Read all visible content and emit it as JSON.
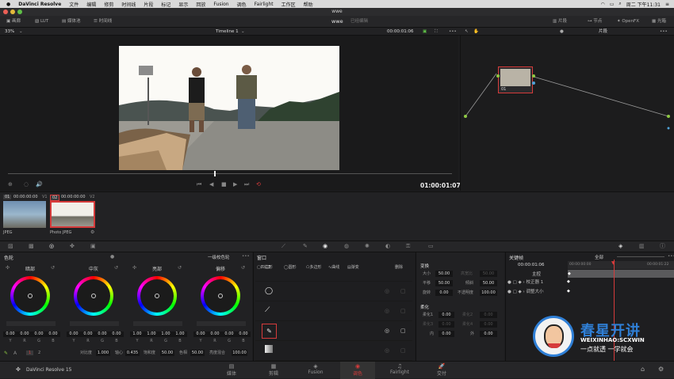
{
  "menubar": {
    "app": "DaVinci Resolve",
    "items": [
      "文件",
      "编辑",
      "修剪",
      "时间线",
      "片段",
      "标记",
      "显示",
      "回放",
      "Fusion",
      "调色",
      "Fairlight",
      "工作区",
      "帮助"
    ],
    "clock": "周二 下午11:31"
  },
  "window": {
    "title": "wwe"
  },
  "toolbar": {
    "gallery": "画廊",
    "lut": "LUT",
    "media_pool": "媒体池",
    "timeline": "时间线",
    "project": "wwe",
    "edited": "已经编辑",
    "clips": "片段",
    "nodes": "节点",
    "openfx": "OpenFX",
    "lightbox": "光箱"
  },
  "viewer": {
    "zoom": "33%",
    "timeline_name": "Timeline 1",
    "timecode": "00:00:01:06",
    "current_tc": "01:00:01:07",
    "node_mode": "片段"
  },
  "node": {
    "label": "01"
  },
  "clips": [
    {
      "index": "01",
      "tc": "00:00:00:00",
      "track": "V1",
      "name": "JPEG"
    },
    {
      "index": "02",
      "tc": "00:00:00:00",
      "track": "V2",
      "name": "Photo JPEG"
    }
  ],
  "wheels": {
    "panel_title": "色轮",
    "mode": "一级校色轮",
    "items": [
      {
        "title": "暗部",
        "values": [
          "0.00",
          "0.00",
          "0.00",
          "0.00"
        ]
      },
      {
        "title": "中灰",
        "values": [
          "0.00",
          "0.00",
          "0.00",
          "0.00"
        ]
      },
      {
        "title": "亮部",
        "values": [
          "1.00",
          "1.00",
          "1.00",
          "1.00"
        ]
      },
      {
        "title": "偏移",
        "values": [
          "0.00",
          "0.00",
          "0.00",
          "0.00"
        ]
      }
    ],
    "channels": [
      "Y",
      "R",
      "G",
      "B"
    ],
    "page1": "1",
    "page2": "2",
    "contrast_label": "对比度",
    "contrast": "1.000",
    "pivot_label": "轴心",
    "pivot": "0.435",
    "saturation_label": "饱和度",
    "saturation": "50.00",
    "hue_label": "色相",
    "hue": "50.00",
    "lum_mix_label": "亮度混合",
    "lum_mix": "100.00"
  },
  "window_panel": {
    "title": "窗口",
    "shapes": [
      "四边形",
      "圆形",
      "多边形",
      "曲线",
      "渐变"
    ],
    "delete": "删除"
  },
  "transform": {
    "title": "变换",
    "size_label": "大小",
    "size": "50.00",
    "aspect_label": "高宽比",
    "aspect": "50.00",
    "pan_label": "平移",
    "pan": "50.00",
    "tilt_label": "倾斜",
    "tilt": "50.00",
    "rotate_label": "旋转",
    "rotate": "0.00",
    "opacity_label": "不透明度",
    "opacity": "100.00",
    "softness_title": "柔化",
    "soft1_label": "柔化1",
    "soft1": "0.00",
    "soft2_label": "柔化2",
    "soft2": "0.00",
    "soft3_label": "柔化3",
    "soft3": "0.00",
    "soft4_label": "柔化4",
    "soft4": "0.00",
    "inside_label": "内",
    "inside": "0.00",
    "outside_label": "外",
    "outside": "0.00"
  },
  "keyframes": {
    "title": "关键帧",
    "all": "全部",
    "tc": "00:00:01:06",
    "ruler_start": "00:00:00:00",
    "ruler_end": "00:00:01:22",
    "master": "主控",
    "tracks": [
      "校正器 1",
      "调整大小"
    ]
  },
  "pages": [
    {
      "label": "媒体",
      "icon": "▤"
    },
    {
      "label": "剪辑",
      "icon": "▦"
    },
    {
      "label": "Fusion",
      "icon": "◈"
    },
    {
      "label": "调色",
      "icon": "◉"
    },
    {
      "label": "Fairlight",
      "icon": "♫"
    },
    {
      "label": "交付",
      "icon": "🚀"
    }
  ],
  "brand": {
    "name": "DaVinci Resolve 15"
  },
  "watermark": {
    "title": "春星开讲",
    "sub": "WEIXINHAO:SCXWIN",
    "slogan": "一点就透 一学就会"
  },
  "colors": {
    "accent": "#d63b3b",
    "panel": "#212123",
    "highlight": "#e34a4a"
  }
}
